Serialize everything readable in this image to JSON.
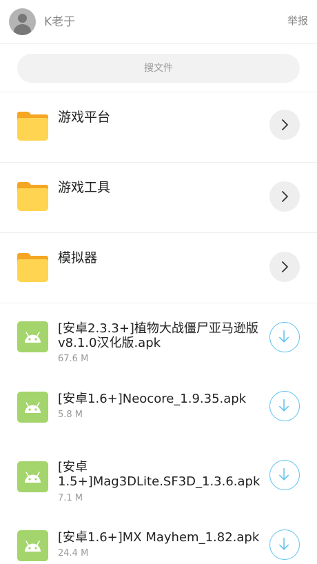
{
  "header": {
    "username": "K老于",
    "report_label": "举报"
  },
  "search": {
    "placeholder": "搜文件"
  },
  "folders": [
    {
      "name": "游戏平台"
    },
    {
      "name": "游戏工具"
    },
    {
      "name": "模拟器"
    }
  ],
  "files": [
    {
      "name": "[安卓2.3.3+]植物大战僵尸亚马逊版v8.1.0汉化版.apk",
      "size": "67.6 M"
    },
    {
      "name": "[安卓1.6+]Neocore_1.9.35.apk",
      "size": "5.8 M"
    },
    {
      "name": "[安卓1.5+]Mag3DLite.SF3D_1.3.6.apk",
      "size": "7.1 M"
    },
    {
      "name": "[安卓1.6+]MX Mayhem_1.82.apk",
      "size": "24.4 M"
    }
  ],
  "icons": {
    "folder": "folder-icon",
    "chevron": "chevron-right-icon",
    "download": "download-icon",
    "apk": "android-apk-icon"
  },
  "colors": {
    "folder_front": "#ffd451",
    "folder_back": "#f5a623",
    "android_green": "#a4d46c",
    "download_accent": "#5ec3ee"
  }
}
